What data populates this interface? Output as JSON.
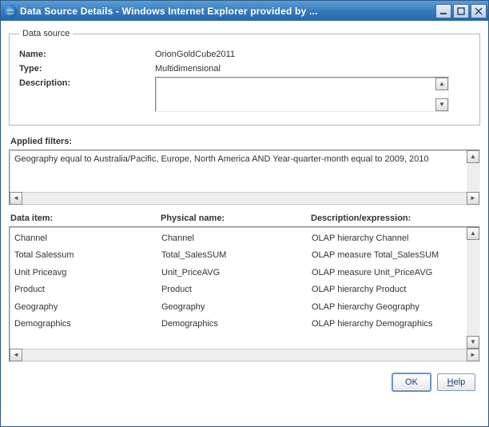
{
  "window": {
    "title": "Data Source Details - Windows Internet Explorer provided by ..."
  },
  "dataSource": {
    "legend": "Data source",
    "nameLabel": "Name:",
    "nameValue": "OrionGoldCube2011",
    "typeLabel": "Type:",
    "typeValue": "Multidimensional",
    "descLabel": "Description:",
    "descValue": ""
  },
  "filters": {
    "label": "Applied filters:",
    "text": "Geography equal to Australia/Pacific, Europe, North America AND Year-quarter-month equal to 2009, 2010"
  },
  "items": {
    "headers": {
      "dataItem": "Data item:",
      "physicalName": "Physical name:",
      "desc": "Description/expression:"
    },
    "rows": [
      {
        "dataItem": "Channel",
        "physicalName": "Channel",
        "desc": "OLAP hierarchy Channel"
      },
      {
        "dataItem": "Total Salessum",
        "physicalName": "Total_SalesSUM",
        "desc": "OLAP measure Total_SalesSUM"
      },
      {
        "dataItem": "Unit Priceavg",
        "physicalName": "Unit_PriceAVG",
        "desc": "OLAP measure Unit_PriceAVG"
      },
      {
        "dataItem": "Product",
        "physicalName": "Product",
        "desc": "OLAP hierarchy Product"
      },
      {
        "dataItem": "Geography",
        "physicalName": "Geography",
        "desc": "OLAP hierarchy Geography"
      },
      {
        "dataItem": "Demographics",
        "physicalName": "Demographics",
        "desc": "OLAP hierarchy Demographics"
      }
    ]
  },
  "buttons": {
    "ok": "OK",
    "help": "Help"
  }
}
